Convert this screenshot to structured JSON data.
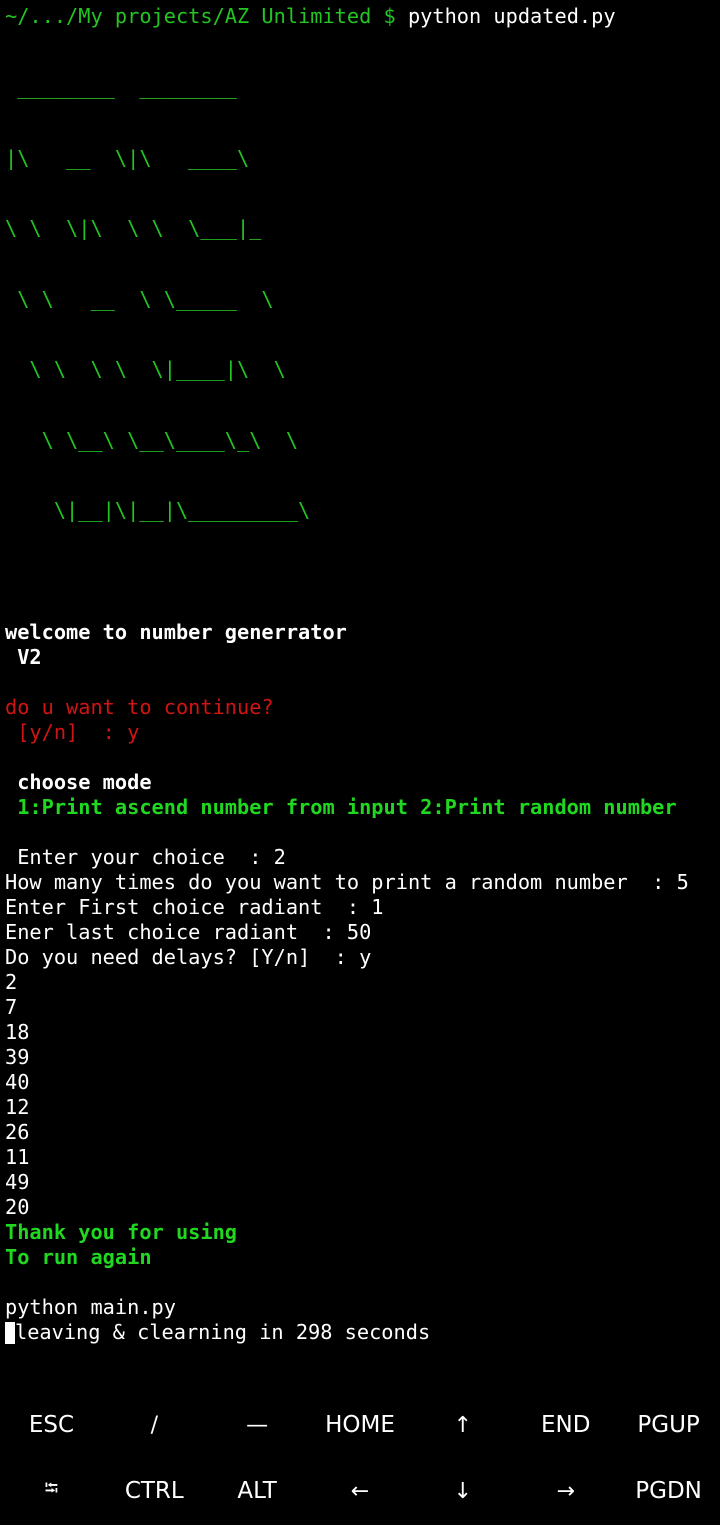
{
  "terminal": {
    "prompt_path": "~/.../My projects/AZ Unlimited $ ",
    "prompt_command": "python updated.py",
    "ascii_art": [
      " ________  ________",
      "|\\   __  \\|\\   ____\\",
      "\\ \\  \\|\\  \\ \\  \\___|_",
      " \\ \\   __  \\ \\_____  \\",
      "  \\ \\  \\ \\  \\|____|\\  \\",
      "   \\ \\__\\ \\__\\____\\_\\  \\",
      "    \\|__|\\|__|\\_________\\"
    ],
    "welcome_line1": "welcome to number generrator",
    "welcome_line2": " V2",
    "continue_question": "do u want to continue?",
    "continue_answer": " [y/n]  : y",
    "choose_mode": " choose mode",
    "mode_options": " 1:Print ascend number from input 2:Print random number",
    "enter_choice": " Enter your choice  : 2",
    "how_many": "How many times do you want to print a random number  : 5",
    "first_radiant": "Enter First choice radiant  : 1",
    "last_radiant": "Ener last choice radiant  : 50",
    "delays": "Do you need delays? [Y/n]  : y",
    "numbers": [
      "2",
      "7",
      "18",
      "39",
      "40",
      "12",
      "26",
      "11",
      "49",
      "20"
    ],
    "thanks": "Thank you for using",
    "run_again": "To run again",
    "run_command": "python main.py",
    "leaving": "leaving & clearning in 298 seconds"
  },
  "extra_keys": {
    "row1": [
      {
        "label": "ESC",
        "name": "esc-key"
      },
      {
        "label": "/",
        "name": "slash-key"
      },
      {
        "label": "—",
        "name": "dash-key"
      },
      {
        "label": "HOME",
        "name": "home-key"
      },
      {
        "label": "↑",
        "name": "up-arrow-key"
      },
      {
        "label": "END",
        "name": "end-key"
      },
      {
        "label": "PGUP",
        "name": "pgup-key"
      }
    ],
    "row2": [
      {
        "label": "⭾",
        "name": "tab-key"
      },
      {
        "label": "CTRL",
        "name": "ctrl-key"
      },
      {
        "label": "ALT",
        "name": "alt-key"
      },
      {
        "label": "←",
        "name": "left-arrow-key"
      },
      {
        "label": "↓",
        "name": "down-arrow-key"
      },
      {
        "label": "→",
        "name": "right-arrow-key"
      },
      {
        "label": "PGDN",
        "name": "pgdn-key"
      }
    ]
  },
  "colors": {
    "background": "#000000",
    "prompt_green": "#23c423",
    "art_green": "#22c422",
    "highlight_green": "#20d820",
    "prompt_red": "#d01414",
    "text": "#ffffff"
  }
}
